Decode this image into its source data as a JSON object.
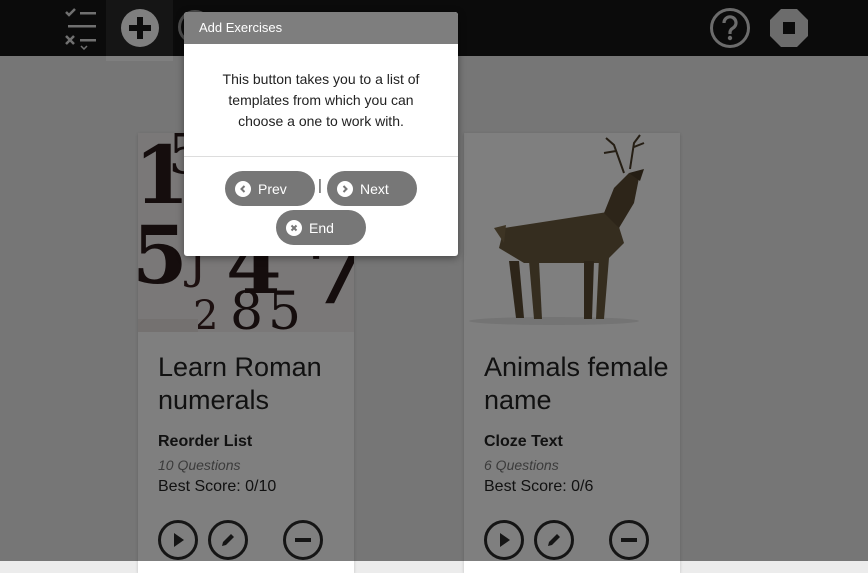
{
  "popup": {
    "title": "Add Exercises",
    "body": "This button takes you to a list of templates from which you can choose a one to work with.",
    "prev_label": "Prev",
    "next_label": "Next",
    "end_label": "End",
    "separator": "|"
  },
  "toolbar": {
    "icons": [
      "list-check-icon",
      "add-icon",
      "help-icon",
      "stop-icon"
    ]
  },
  "exercises": [
    {
      "title": "Learn Roman numerals",
      "type": "Reorder List",
      "questions": "10 Questions",
      "best_score": "Best Score: 0/10"
    },
    {
      "title": "Animals female name",
      "type": "Cloze Text",
      "questions": "6 Questions",
      "best_score": "Best Score: 0/6"
    }
  ],
  "colors": {
    "toolbar_bg": "#161616",
    "popup_header": "#7e7e7e",
    "popup_button": "#777777",
    "overlay": "rgba(0,0,0,0.5)"
  }
}
